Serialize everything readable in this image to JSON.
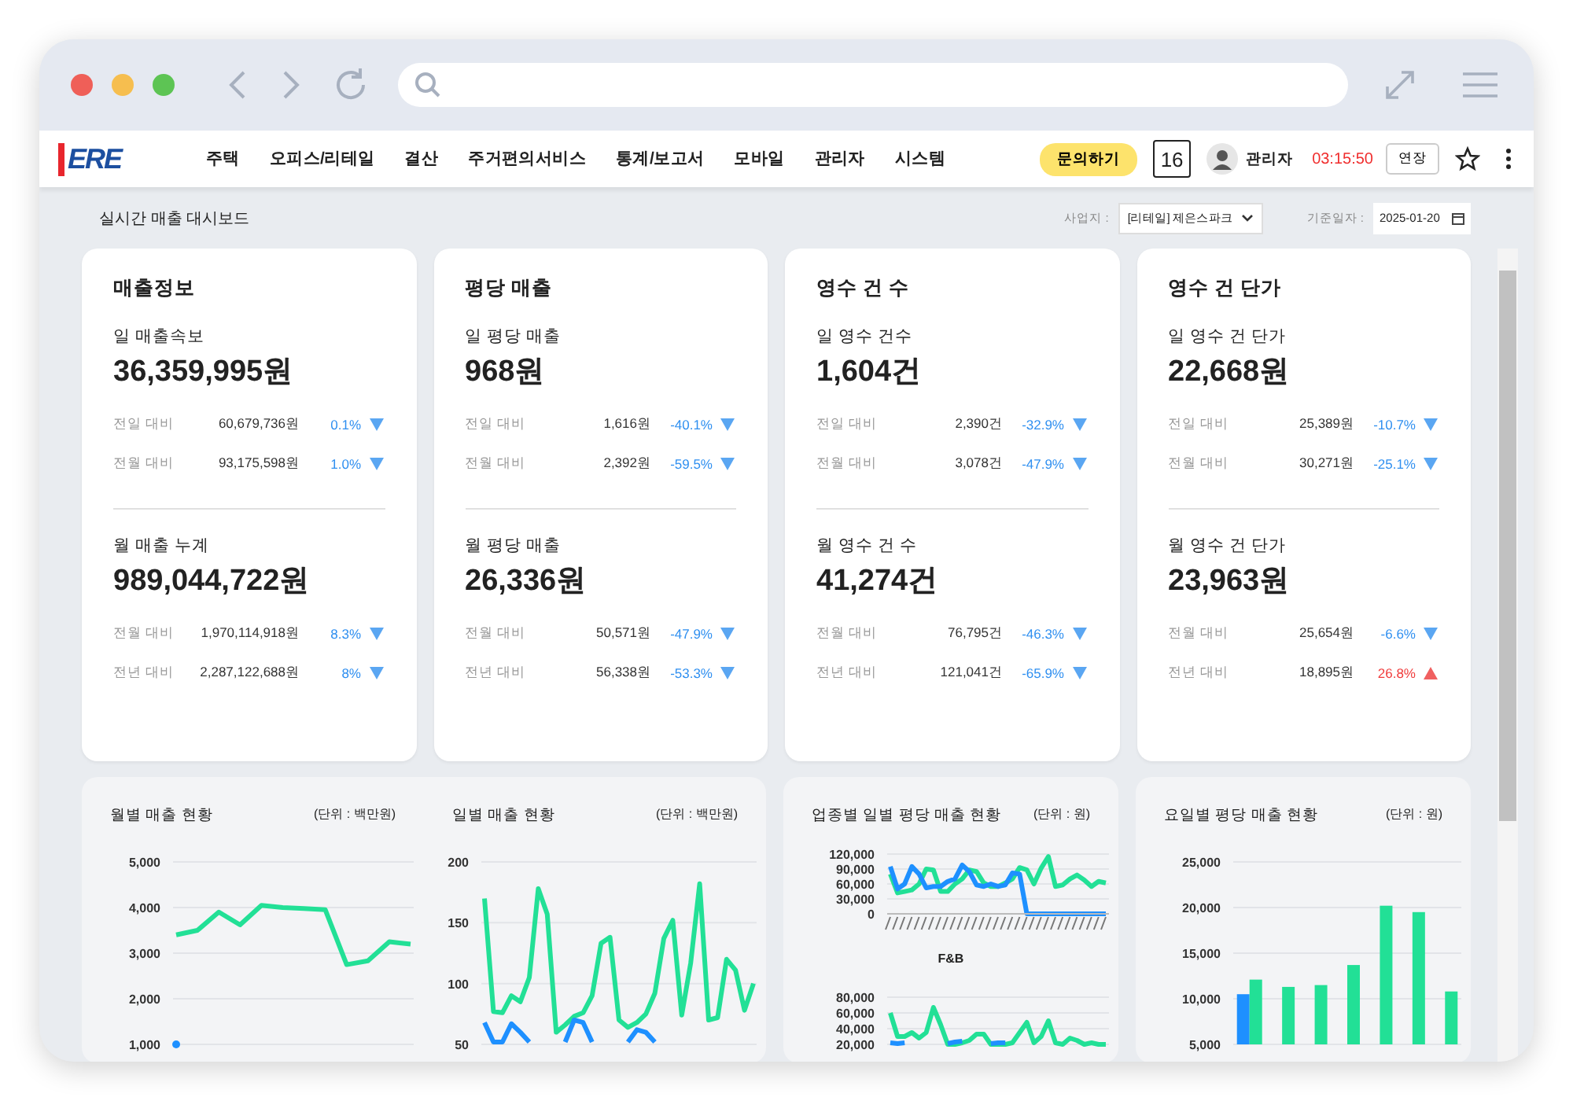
{
  "header": {
    "logo": "ERE",
    "nav": [
      {
        "label": "주택"
      },
      {
        "label": "오피스/리테일"
      },
      {
        "label": "결산"
      },
      {
        "label": "주거편의서비스"
      },
      {
        "label": "통계/보고서"
      },
      {
        "label": "모바일"
      },
      {
        "label": "관리자"
      },
      {
        "label": "시스템"
      }
    ],
    "inquiry_button": "문의하기",
    "calendar_day": "16",
    "user": "관리자",
    "session_timer": "03:15:50",
    "extend_button": "연장"
  },
  "page_title": "실시간 매출 대시보드",
  "filters": {
    "site_label": "사업지 :",
    "site_value": "[리테일] 제은스파크",
    "date_label": "기준일자 :",
    "date_value": "2025-01-20"
  },
  "cards": [
    {
      "title": "매출정보",
      "sections": [
        {
          "label": "일 매출속보",
          "value": "36,359,995원",
          "comparisons": [
            {
              "label": "전일 대비",
              "amount": "60,679,736원",
              "change": "0.1%",
              "increase": false
            },
            {
              "label": "전월 대비",
              "amount": "93,175,598원",
              "change": "1.0%",
              "increase": false
            }
          ]
        },
        {
          "label": "월 매출 누계",
          "value": "989,044,722원",
          "comparisons": [
            {
              "label": "전월 대비",
              "amount": "1,970,114,918원",
              "change": "8.3%",
              "increase": false
            },
            {
              "label": "전년 대비",
              "amount": "2,287,122,688원",
              "change": "8%",
              "increase": false
            }
          ]
        }
      ]
    },
    {
      "title": "평당 매출",
      "sections": [
        {
          "label": "일 평당 매출",
          "value": "968원",
          "comparisons": [
            {
              "label": "전일 대비",
              "amount": "1,616원",
              "change": "-40.1%",
              "increase": false
            },
            {
              "label": "전월 대비",
              "amount": "2,392원",
              "change": "-59.5%",
              "increase": false
            }
          ]
        },
        {
          "label": "월 평당 매출",
          "value": "26,336원",
          "comparisons": [
            {
              "label": "전월 대비",
              "amount": "50,571원",
              "change": "-47.9%",
              "increase": false
            },
            {
              "label": "전년 대비",
              "amount": "56,338원",
              "change": "-53.3%",
              "increase": false
            }
          ]
        }
      ]
    },
    {
      "title": "영수 건 수",
      "sections": [
        {
          "label": "일 영수 건수",
          "value": "1,604건",
          "comparisons": [
            {
              "label": "전일 대비",
              "amount": "2,390건",
              "change": "-32.9%",
              "increase": false
            },
            {
              "label": "전월 대비",
              "amount": "3,078건",
              "change": "-47.9%",
              "increase": false
            }
          ]
        },
        {
          "label": "월 영수 건 수",
          "value": "41,274건",
          "comparisons": [
            {
              "label": "전월 대비",
              "amount": "76,795건",
              "change": "-46.3%",
              "increase": false
            },
            {
              "label": "전년 대비",
              "amount": "121,041건",
              "change": "-65.9%",
              "increase": false
            }
          ]
        }
      ]
    },
    {
      "title": "영수 건 단가",
      "sections": [
        {
          "label": "일 영수 건 단가",
          "value": "22,668원",
          "comparisons": [
            {
              "label": "전일 대비",
              "amount": "25,389원",
              "change": "-10.7%",
              "increase": false
            },
            {
              "label": "전월 대비",
              "amount": "30,271원",
              "change": "-25.1%",
              "increase": false
            }
          ]
        },
        {
          "label": "월 영수 건 단가",
          "value": "23,963원",
          "comparisons": [
            {
              "label": "전월 대비",
              "amount": "25,654원",
              "change": "-6.6%",
              "increase": false
            },
            {
              "label": "전년 대비",
              "amount": "18,895원",
              "change": "26.8%",
              "increase": true
            }
          ]
        }
      ]
    }
  ],
  "panels": [
    {
      "charts": [
        {
          "title": "월별 매출 현황",
          "unit": "(단위 : 백만원)",
          "chart_data": {
            "type": "line",
            "grid": true,
            "ylim": [
              1000,
              5000
            ],
            "yticks": [
              {
                "value": 1000,
                "label": "1,000"
              },
              {
                "value": 2000,
                "label": "2,000"
              },
              {
                "value": 3000,
                "label": "3,000"
              },
              {
                "value": 4000,
                "label": "4,000"
              },
              {
                "value": 5000,
                "label": "5,000"
              }
            ],
            "series": [
              {
                "color": "#22e096",
                "values": [
                  3400,
                  3500,
                  3900,
                  3620,
                  4050,
                  4000,
                  3980,
                  3950,
                  2750,
                  2830,
                  3250,
                  3200
                ]
              },
              {
                "color": "#1e90ff",
                "marker": true,
                "values": [
                  1000,
                  null,
                  null,
                  null,
                  null,
                  null,
                  null,
                  null,
                  null,
                  null,
                  null,
                  null
                ]
              }
            ]
          }
        },
        {
          "title": "일별 매출 현황",
          "unit": "(단위 : 백만원)",
          "chart_data": {
            "type": "line",
            "grid": true,
            "ylim": [
              50,
              200
            ],
            "yticks": [
              {
                "value": 50,
                "label": "50"
              },
              {
                "value": 100,
                "label": "100"
              },
              {
                "value": 150,
                "label": "150"
              },
              {
                "value": 200,
                "label": "200"
              }
            ],
            "series": [
              {
                "color": "#22e096",
                "values": [
                  170,
                  77,
                  76,
                  90,
                  85,
                  105,
                  178,
                  157,
                  60,
                  66,
                  73,
                  76,
                  90,
                  133,
                  138,
                  70,
                  64,
                  68,
                  75,
                  92,
                  137,
                  152,
                  74,
                  117,
                  182,
                  70,
                  72,
                  120,
                  111,
                  78,
                  100
                ]
              },
              {
                "color": "#1e90ff",
                "values": [
                  68,
                  52,
                  52,
                  67,
                  60,
                  52,
                  null,
                  null,
                  null,
                  52,
                  70,
                  68,
                  52,
                  null,
                  null,
                  null,
                  52,
                  62,
                  60,
                  52,
                  null,
                  null,
                  null,
                  null,
                  null,
                  null,
                  null,
                  null,
                  null,
                  null,
                  null
                ]
              }
            ]
          }
        }
      ]
    },
    {
      "charts": [
        {
          "title": "업종별 일별 평당 매출 현황",
          "unit": "(단위 : 원)",
          "chart_data": {
            "type": "line",
            "title": "F&B",
            "grid": true,
            "ylim": [
              0,
              120000
            ],
            "yticks": [
              {
                "value": 0,
                "label": "0"
              },
              {
                "value": 30000,
                "label": "30,000"
              },
              {
                "value": 60000,
                "label": "60,000"
              },
              {
                "value": 90000,
                "label": "90,000"
              },
              {
                "value": 120000,
                "label": "120,000"
              }
            ],
            "series": [
              {
                "color": "#22e096",
                "values": [
                  80000,
                  42000,
                  45000,
                  48000,
                  60000,
                  90000,
                  88000,
                  45000,
                  45000,
                  60000,
                  70000,
                  88000,
                  85000,
                  62000,
                  55000,
                  55000,
                  62000,
                  70000,
                  93000,
                  88000,
                  60000,
                  92000,
                  115000,
                  55000,
                  58000,
                  70000,
                  78000,
                  68000,
                  55000,
                  65000,
                  62000
                ]
              },
              {
                "color": "#1e90ff",
                "values": [
                  95000,
                  50000,
                  60000,
                  95000,
                  80000,
                  52000,
                  55000,
                  55000,
                  65000,
                  70000,
                  98000,
                  85000,
                  58000,
                  55000,
                  60000,
                  55000,
                  58000,
                  82000,
                  80000,
                  0,
                  0,
                  0,
                  0,
                  0,
                  0,
                  0,
                  0,
                  0,
                  0,
                  0,
                  0
                ]
              }
            ]
          }
        },
        {
          "chart_data": {
            "type": "line",
            "grid": true,
            "ylim": [
              20000,
              80000
            ],
            "yticks": [
              {
                "value": 20000,
                "label": "20,000"
              },
              {
                "value": 40000,
                "label": "40,000"
              },
              {
                "value": 60000,
                "label": "60,000"
              },
              {
                "value": 80000,
                "label": "80,000"
              }
            ],
            "series": [
              {
                "color": "#22e096",
                "values": [
                  60000,
                  30000,
                  30000,
                  35000,
                  28000,
                  35000,
                  67000,
                  45000,
                  20000,
                  20000,
                  22000,
                  25000,
                  33000,
                  33000,
                  20000,
                  20000,
                  20000,
                  22000,
                  35000,
                  48000,
                  22000,
                  30000,
                  50000,
                  22000,
                  20000,
                  28000,
                  25000,
                  20000,
                  22000,
                  20000,
                  20000
                ]
              },
              {
                "color": "#1e90ff",
                "values": [
                  22000,
                  21000,
                  22000,
                  null,
                  null,
                  null,
                  null,
                  null,
                  21000,
                  23000,
                  24000,
                  null,
                  null,
                  null,
                  21000,
                  22000,
                  22000,
                  null,
                  null,
                  null,
                  null,
                  null,
                  null,
                  null,
                  null,
                  null,
                  null,
                  null,
                  null,
                  null,
                  null
                ]
              }
            ]
          }
        }
      ]
    },
    {
      "charts": [
        {
          "title": "요일별 평당 매출 현황",
          "unit": "(단위 : 원)",
          "chart_data": {
            "type": "bar",
            "grid": true,
            "ylim": [
              5000,
              25000
            ],
            "yticks": [
              {
                "value": 5000,
                "label": "5,000"
              },
              {
                "value": 10000,
                "label": "10,000"
              },
              {
                "value": 15000,
                "label": "15,000"
              },
              {
                "value": 20000,
                "label": "20,000"
              },
              {
                "value": 25000,
                "label": "25,000"
              }
            ],
            "series": [
              {
                "color": "#1e90ff",
                "values": [
                  10500,
                  null,
                  null,
                  null,
                  null,
                  null,
                  null
                ]
              },
              {
                "color": "#22e096",
                "values": [
                  12100,
                  11300,
                  11500,
                  13700,
                  20200,
                  19500,
                  10800
                ]
              }
            ]
          }
        }
      ]
    }
  ]
}
